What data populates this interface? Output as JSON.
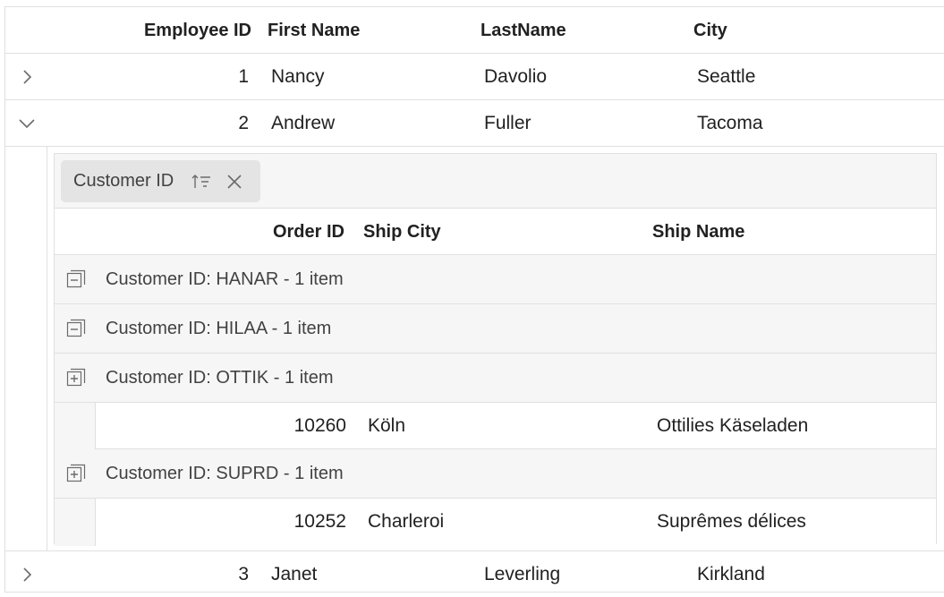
{
  "parent_grid": {
    "columns": [
      "Employee ID",
      "First Name",
      "LastName",
      "City"
    ],
    "rows": [
      {
        "id": "1",
        "first": "Nancy",
        "last": "Davolio",
        "city": "Seattle",
        "expanded": false
      },
      {
        "id": "2",
        "first": "Andrew",
        "last": "Fuller",
        "city": "Tacoma",
        "expanded": true
      },
      {
        "id": "3",
        "first": "Janet",
        "last": "Leverling",
        "city": "Kirkland",
        "expanded": false
      }
    ]
  },
  "child_grid": {
    "group_chip": {
      "label": "Customer ID",
      "sort_icon": "sort-ascending-icon",
      "close_icon": "close-icon"
    },
    "columns": [
      "Order ID",
      "Ship City",
      "Ship Name"
    ],
    "groups": [
      {
        "caption": "Customer ID: HANAR - 1 item",
        "icon": "collapse-group-icon",
        "rows": []
      },
      {
        "caption": "Customer ID: HILAA - 1 item",
        "icon": "collapse-group-icon",
        "rows": []
      },
      {
        "caption": "Customer ID: OTTIK - 1 item",
        "icon": "expand-group-icon",
        "rows": [
          {
            "order_id": "10260",
            "ship_city": "Köln",
            "ship_name": "Ottilies Käseladen"
          }
        ]
      },
      {
        "caption": "Customer ID: SUPRD - 1 item",
        "icon": "expand-group-icon",
        "rows": [
          {
            "order_id": "10252",
            "ship_city": "Charleroi",
            "ship_name": "Suprêmes délices"
          }
        ]
      }
    ]
  },
  "colors": {
    "border": "#e0e0e0",
    "group_bg": "#f6f6f6",
    "chip_bg": "#e4e4e4",
    "text": "#212121",
    "icon": "#6b6b6b"
  }
}
